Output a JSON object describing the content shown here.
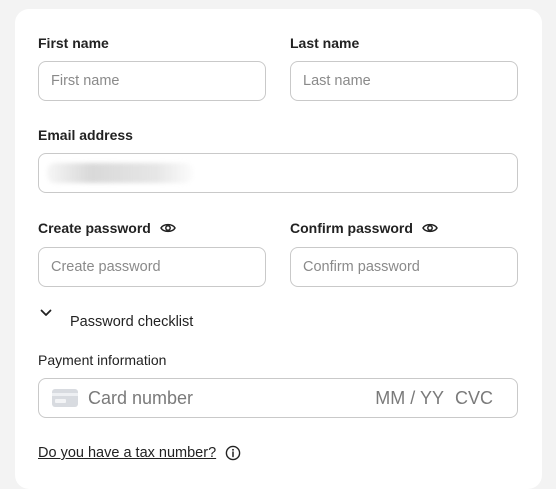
{
  "name": {
    "first_label": "First name",
    "first_placeholder": "First name",
    "last_label": "Last name",
    "last_placeholder": "Last name"
  },
  "email": {
    "label": "Email address"
  },
  "password": {
    "create_label": "Create password",
    "create_placeholder": "Create password",
    "confirm_label": "Confirm password",
    "confirm_placeholder": "Confirm password",
    "checklist_label": "Password checklist",
    "show_icon": "eye-icon",
    "checklist_icon": "chevron-down-icon"
  },
  "payment": {
    "label": "Payment information",
    "card_placeholder": "Card number",
    "expiry_placeholder": "MM / YY",
    "cvc_placeholder": "CVC",
    "card_icon": "credit-card-icon"
  },
  "tax": {
    "link_label": "Do you have a tax number?",
    "info_icon": "info-icon"
  }
}
